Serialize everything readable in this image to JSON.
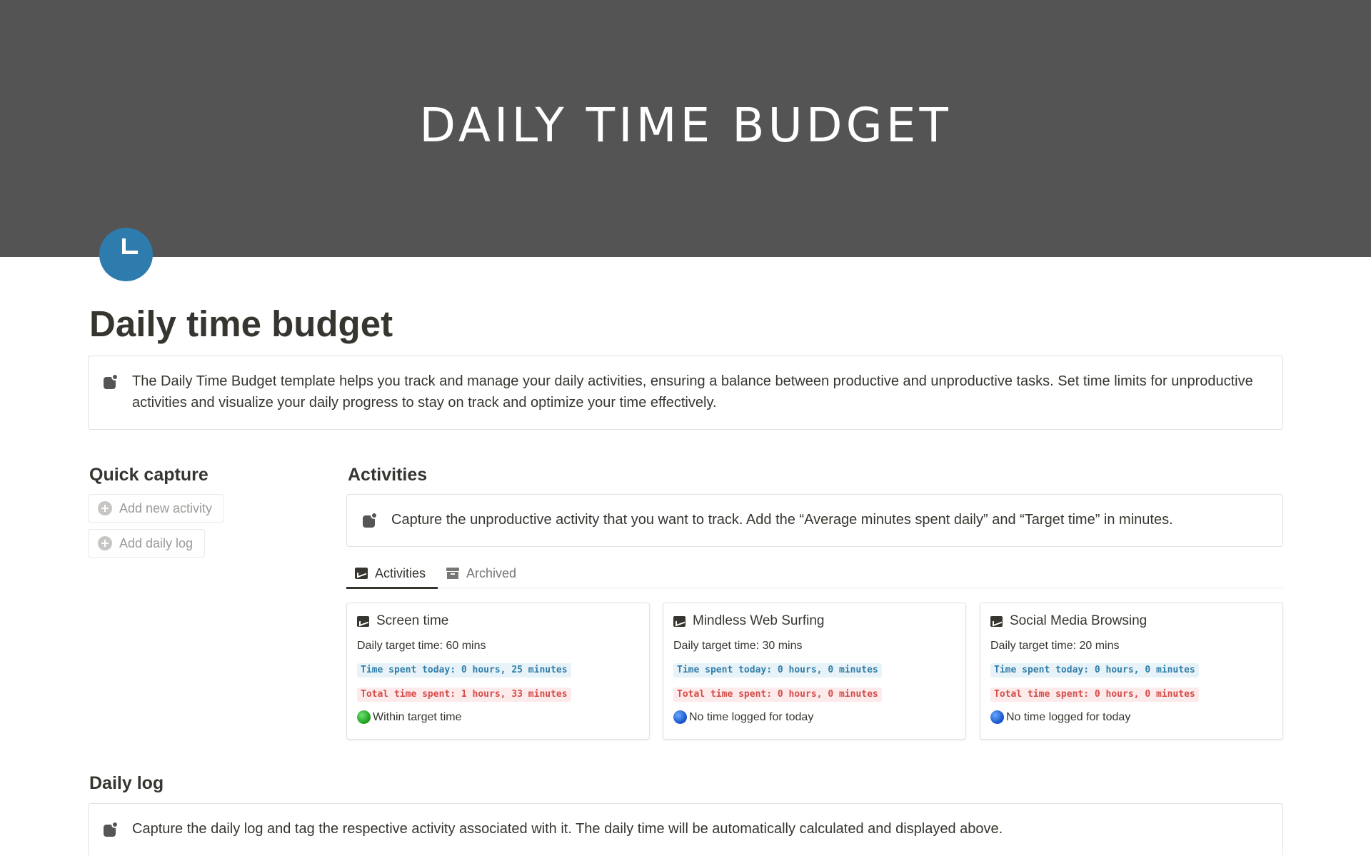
{
  "cover": {
    "title": "DAILY TIME BUDGET"
  },
  "page": {
    "icon": "clock-icon",
    "title": "Daily time budget",
    "intro": "The Daily Time Budget template helps you track and manage your daily activities, ensuring a balance between productive and unproductive tasks. Set time limits for unproductive activities and visualize your daily progress to stay on track and optimize your time effectively."
  },
  "quick_capture": {
    "heading": "Quick capture",
    "buttons": [
      {
        "label": "Add new activity",
        "icon": "plus-circle-icon"
      },
      {
        "label": "Add daily log",
        "icon": "plus-circle-icon"
      }
    ]
  },
  "activities": {
    "heading": "Activities",
    "callout": "Capture the unproductive activity that you want to track. Add the “Average minutes spent daily” and “Target time” in minutes.",
    "tabs": [
      {
        "label": "Activities",
        "icon": "chart-icon",
        "active": true
      },
      {
        "label": "Archived",
        "icon": "archive-icon",
        "active": false
      }
    ],
    "cards": [
      {
        "title": "Screen time",
        "target": "Daily target time: 60 mins",
        "today": "Time spent today: 0 hours, 25 minutes",
        "total": "Total time spent: 1 hours, 33 minutes",
        "status_icon": "green-circle",
        "status": "Within target time"
      },
      {
        "title": "Mindless Web Surfing",
        "target": "Daily target time: 30 mins",
        "today": "Time spent today: 0 hours, 0 minutes",
        "total": "Total time spent: 0 hours, 0 minutes",
        "status_icon": "blue-circle",
        "status": "No time logged for today"
      },
      {
        "title": "Social Media Browsing",
        "target": "Daily target time: 20 mins",
        "today": "Time spent today: 0 hours, 0 minutes",
        "total": "Total time spent: 0 hours, 0 minutes",
        "status_icon": "blue-circle",
        "status": "No time logged for today"
      }
    ]
  },
  "daily_log": {
    "heading": "Daily log",
    "callout": "Capture the daily log and tag the respective activity associated with it. The daily time will be automatically calculated and displayed above."
  },
  "colors": {
    "cover_bg": "#545454",
    "icon_bg": "#2e7bad",
    "blue_tag_bg": "#e7f3f8",
    "blue_tag_text": "#337ea9",
    "red_tag_bg": "#fdebec",
    "red_tag_text": "#d44c47"
  }
}
